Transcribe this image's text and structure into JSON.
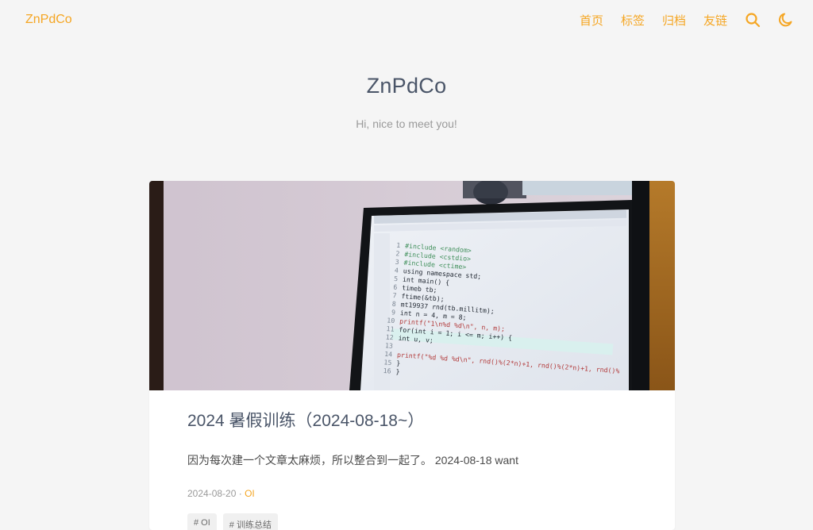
{
  "header": {
    "brand": "ZnPdCo",
    "nav": [
      "首页",
      "标签",
      "归档",
      "友链"
    ],
    "accent_color": "#f5a623",
    "icons": [
      "search-icon",
      "moon-icon"
    ]
  },
  "hero": {
    "title": "ZnPdCo",
    "subtitle": "Hi, nice to meet you!"
  },
  "post": {
    "title": "2024 暑假训练（2024-08-18~）",
    "excerpt": "因为每次建一个文章太麻烦，所以整合到一起了。 2024-08-18 want",
    "date": "2024-08-20",
    "separator": " · ",
    "category": "OI",
    "tags": [
      "# OI",
      "# 训练总结"
    ],
    "cover": {
      "code_lines": [
        "#include <random>",
        "#include <cstdio>",
        "#include <ctime>",
        "using namespace std;",
        "int main() {",
        "    timeb tb;",
        "    ftime(&tb);",
        "    mt19937 rnd(tb.millitm);",
        "    int n = 4, m = 8;",
        "    printf(\"1\\n%d %d\\n\", n, m);",
        "    for(int i = 1; i <= m; i++) {",
        "        int u, v;",
        "",
        "        printf(\"%d %d %d\\n\", rnd()%(2*n)+1, rnd()%(2*n)+1, rnd()%",
        "    }",
        "}"
      ]
    }
  }
}
